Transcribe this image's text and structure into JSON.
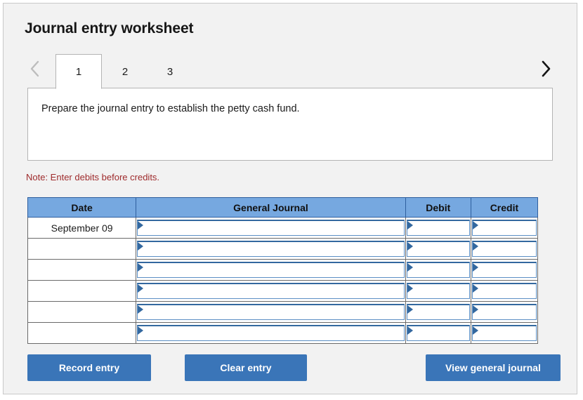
{
  "page": {
    "title": "Journal entry worksheet"
  },
  "tabs": {
    "prev_icon": "chevron-left-icon",
    "next_icon": "chevron-right-icon",
    "items": [
      {
        "label": "1",
        "active": true
      },
      {
        "label": "2",
        "active": false
      },
      {
        "label": "3",
        "active": false
      }
    ]
  },
  "instruction": {
    "text": "Prepare the journal entry to establish the petty cash fund."
  },
  "note": {
    "text": "Note: Enter debits before credits."
  },
  "table": {
    "headers": {
      "date": "Date",
      "general_journal": "General Journal",
      "debit": "Debit",
      "credit": "Credit"
    },
    "rows": [
      {
        "date": "September 09",
        "general_journal": "",
        "debit": "",
        "credit": ""
      },
      {
        "date": "",
        "general_journal": "",
        "debit": "",
        "credit": ""
      },
      {
        "date": "",
        "general_journal": "",
        "debit": "",
        "credit": ""
      },
      {
        "date": "",
        "general_journal": "",
        "debit": "",
        "credit": ""
      },
      {
        "date": "",
        "general_journal": "",
        "debit": "",
        "credit": ""
      },
      {
        "date": "",
        "general_journal": "",
        "debit": "",
        "credit": ""
      }
    ]
  },
  "buttons": {
    "record_entry": "Record entry",
    "clear_entry": "Clear entry",
    "view_general_journal": "View general journal"
  },
  "colors": {
    "header_blue": "#76a8e0",
    "button_blue": "#3a75b8",
    "note_red": "#9e2a2b",
    "page_background": "#f2f2f2"
  }
}
